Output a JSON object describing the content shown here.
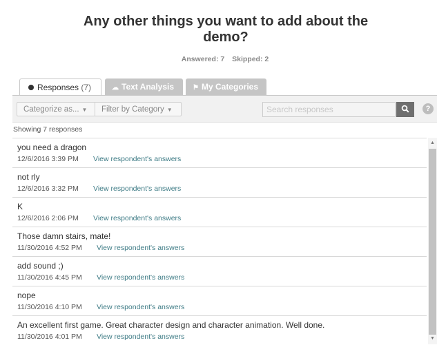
{
  "question": {
    "title": "Any other things you want to add about the demo?",
    "answered": "Answered: 7",
    "skipped": "Skipped: 2"
  },
  "tabs": {
    "responses_label": "Responses",
    "responses_count": "(7)",
    "text_analysis": "Text Analysis",
    "my_categories": "My Categories"
  },
  "toolbar": {
    "categorize": "Categorize as...",
    "filter": "Filter by Category",
    "search_placeholder": "Search responses",
    "help": "?"
  },
  "showing": "Showing 7 responses",
  "responses": [
    {
      "text": "you need a dragon",
      "date": "12/6/2016 3:39 PM",
      "link": "View respondent's answers"
    },
    {
      "text": "not rly",
      "date": "12/6/2016 3:32 PM",
      "link": "View respondent's answers"
    },
    {
      "text": "K",
      "date": "12/6/2016 2:06 PM",
      "link": "View respondent's answers"
    },
    {
      "text": "Those damn stairs, mate!",
      "date": "11/30/2016 4:52 PM",
      "link": "View respondent's answers"
    },
    {
      "text": "add sound ;)",
      "date": "11/30/2016 4:45 PM",
      "link": "View respondent's answers"
    },
    {
      "text": "nope",
      "date": "11/30/2016 4:10 PM",
      "link": "View respondent's answers"
    },
    {
      "text": "An excellent first game. Great character design and character animation. Well done.",
      "date": "11/30/2016 4:01 PM",
      "link": "View respondent's answers"
    }
  ],
  "icons": {
    "search": "search-icon",
    "help": "help-icon",
    "dropdown": "chevron-down-icon"
  },
  "colors": {
    "link": "#3f7c86",
    "tab_inactive": "#c5c5c5",
    "search_button": "#6f6f6f"
  }
}
